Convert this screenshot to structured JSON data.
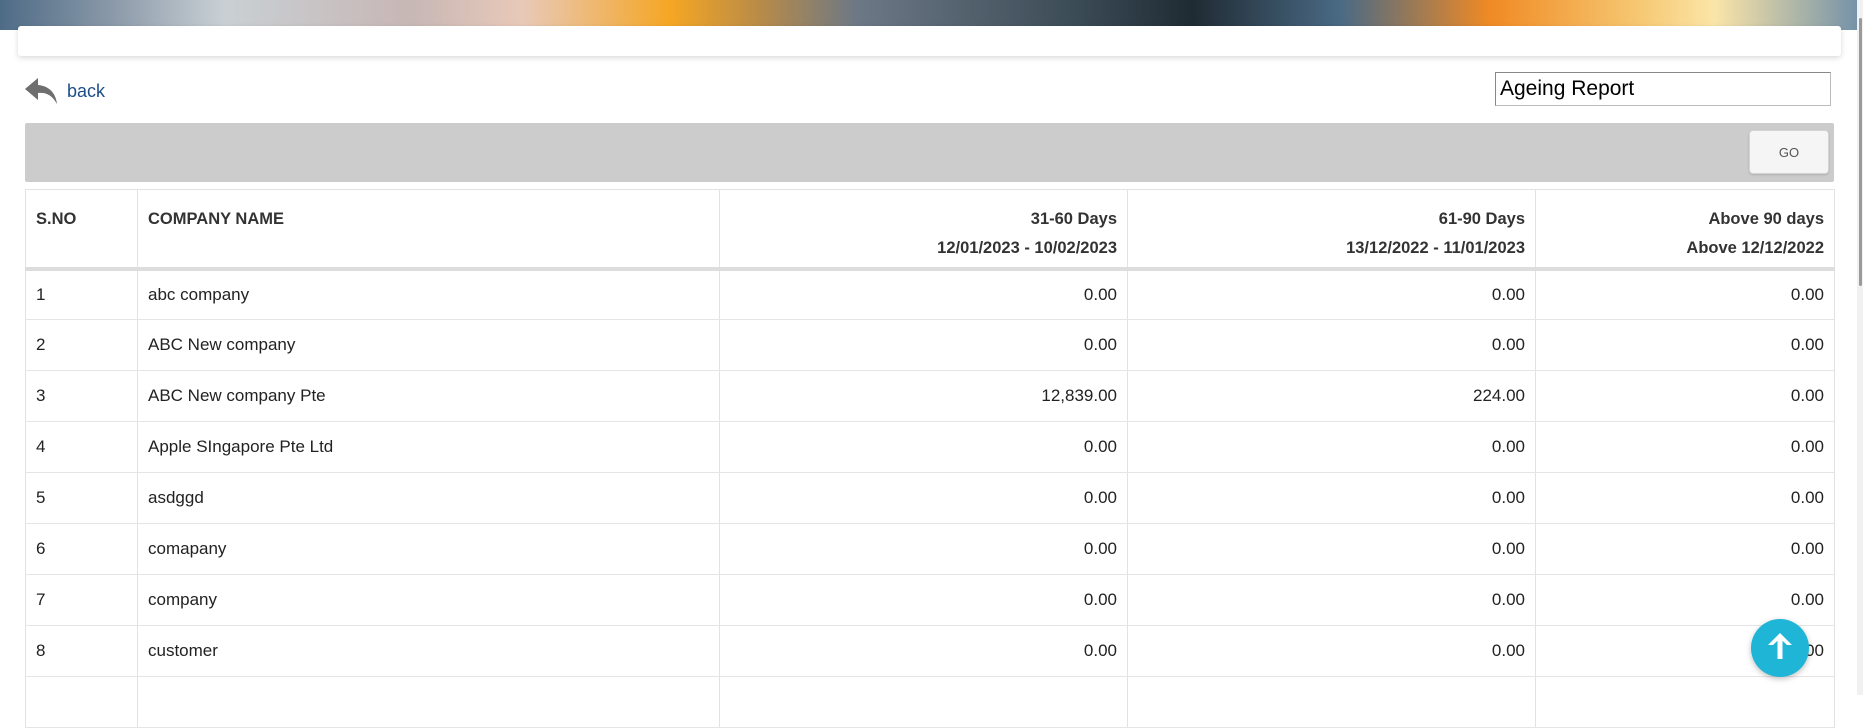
{
  "header": {
    "title": "Ageing Report"
  },
  "nav": {
    "back_label": "back",
    "back_icon": "reply-arrow-icon"
  },
  "filter": {
    "go_label": "GO"
  },
  "table": {
    "columns": [
      {
        "title": "S.NO",
        "sub": ""
      },
      {
        "title": "COMPANY NAME",
        "sub": ""
      },
      {
        "title": "31-60 Days",
        "sub": "12/01/2023 - 10/02/2023"
      },
      {
        "title": "61-90 Days",
        "sub": "13/12/2022 - 11/01/2023"
      },
      {
        "title": "Above 90 days",
        "sub": "Above 12/12/2022"
      }
    ],
    "rows": [
      {
        "sno": "1",
        "company": "abc company",
        "d31_60": "0.00",
        "d61_90": "0.00",
        "d90plus": "0.00"
      },
      {
        "sno": "2",
        "company": "ABC New company",
        "d31_60": "0.00",
        "d61_90": "0.00",
        "d90plus": "0.00"
      },
      {
        "sno": "3",
        "company": "ABC New company Pte",
        "d31_60": "12,839.00",
        "d61_90": "224.00",
        "d90plus": "0.00"
      },
      {
        "sno": "4",
        "company": "Apple SIngapore Pte Ltd",
        "d31_60": "0.00",
        "d61_90": "0.00",
        "d90plus": "0.00"
      },
      {
        "sno": "5",
        "company": "asdggd",
        "d31_60": "0.00",
        "d61_90": "0.00",
        "d90plus": "0.00"
      },
      {
        "sno": "6",
        "company": "comapany",
        "d31_60": "0.00",
        "d61_90": "0.00",
        "d90plus": "0.00"
      },
      {
        "sno": "7",
        "company": "company",
        "d31_60": "0.00",
        "d61_90": "0.00",
        "d90plus": "0.00"
      },
      {
        "sno": "8",
        "company": "customer",
        "d31_60": "0.00",
        "d61_90": "0.00",
        "d90plus": "0.00"
      },
      {
        "sno": "",
        "company": "",
        "d31_60": "",
        "d61_90": "",
        "d90plus": ""
      }
    ]
  },
  "fab": {
    "icon": "arrow-up-icon"
  },
  "colors": {
    "fab": "#1fb5d6",
    "filter_bar": "#cccccc",
    "link": "#1d4e89"
  }
}
